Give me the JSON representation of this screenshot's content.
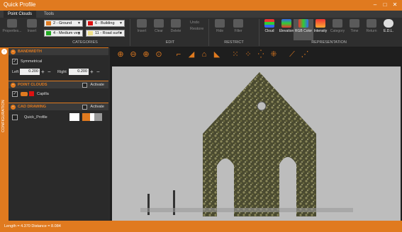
{
  "window": {
    "title": "Quick Profile",
    "minimize": "–",
    "maximize": "□",
    "close": "✕"
  },
  "tabs": [
    {
      "label": "Point Clouds"
    },
    {
      "label": "Tools"
    }
  ],
  "ribbon": {
    "properties": "Properties...",
    "insert_left": "Insert",
    "categories": [
      {
        "label": "2 - Ground",
        "color": "#e07a1f"
      },
      {
        "label": "6 - Building",
        "color": "#d11"
      },
      {
        "label": "4 - Medium veg",
        "color": "#2a2"
      },
      {
        "label": "11 - Road surfa",
        "color": "#f0e08a"
      }
    ],
    "categories_group": "CATEGORIES",
    "edit": {
      "insert": "Insert",
      "clear": "Clear",
      "delete": "Delete",
      "undo": "Undo",
      "restore": "Restore",
      "group": "EDIT"
    },
    "restrict": {
      "hide": "Hide",
      "filter": "Filter",
      "group": "RESTRICT"
    },
    "representation": {
      "cloud": "Cloud",
      "elevation": "Elevation",
      "rgb": "RGB Color",
      "intensity": "Intensity",
      "category": "Category",
      "time": "Time",
      "return": "Return",
      "edl": "E.D.L.",
      "group": "REPRESENTATION"
    }
  },
  "sidebar": {
    "strip_label": "CONFIGURATION",
    "bandwidth": {
      "title": "BANDWIDTH",
      "symmetrical": "Symmetrical",
      "left_label": "Left",
      "left_value": "0.200",
      "right_label": "Right",
      "right_value": "0.200"
    },
    "point_clouds": {
      "title": "POINT CLOUDS",
      "activate": "Activate",
      "item": "Capilla"
    },
    "cad_drawing": {
      "title": "CAD DRAWING",
      "activate": "Activate",
      "item": "Quick_Profile"
    }
  },
  "status": {
    "text": "Length = 4.370 Distance = 8.084"
  }
}
